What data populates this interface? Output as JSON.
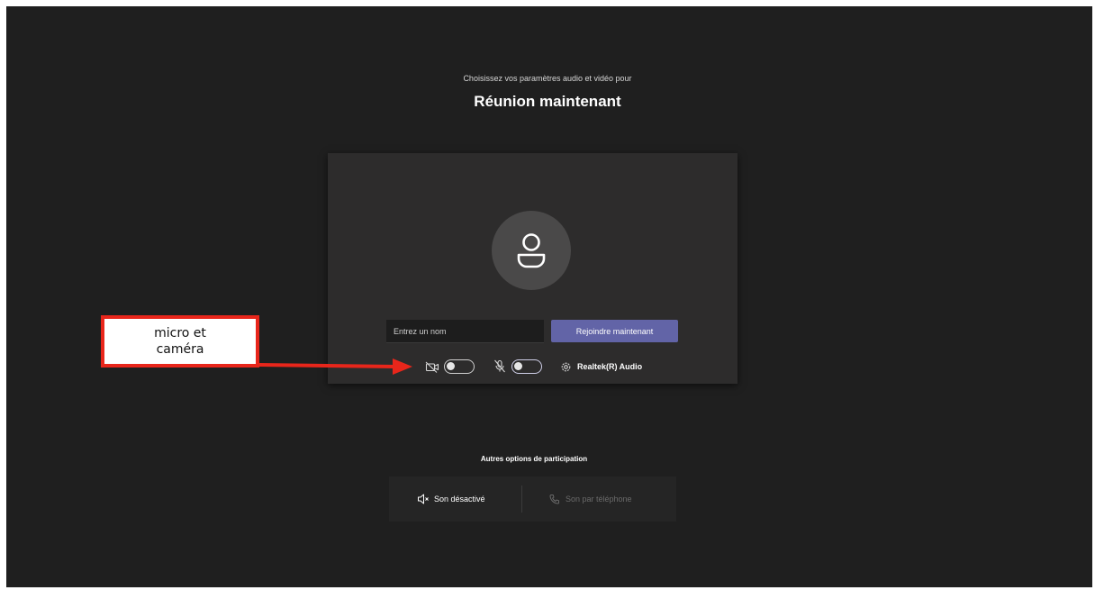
{
  "header": {
    "subtitle": "Choisissez vos paramètres audio et vidéo pour",
    "title": "Réunion maintenant"
  },
  "prejoin": {
    "name_placeholder": "Entrez un nom",
    "join_label": "Rejoindre maintenant",
    "camera": {
      "icon": "camera-off-icon",
      "enabled": false
    },
    "microphone": {
      "icon": "mic-off-icon",
      "enabled": false
    },
    "audio_device": {
      "icon": "gear-icon",
      "label": "Realtek(R) Audio"
    }
  },
  "other_options": {
    "title": "Autres options de participation",
    "items": [
      {
        "icon": "speaker-muted-icon",
        "label": "Son désactivé",
        "enabled": true
      },
      {
        "icon": "phone-icon",
        "label": "Son par téléphone",
        "enabled": false
      }
    ]
  },
  "annotation": {
    "line1": "micro et",
    "line2": "caméra",
    "color": "#e8261b"
  },
  "colors": {
    "background": "#1f1f1f",
    "card": "#2d2c2c",
    "accent": "#6264a7"
  }
}
